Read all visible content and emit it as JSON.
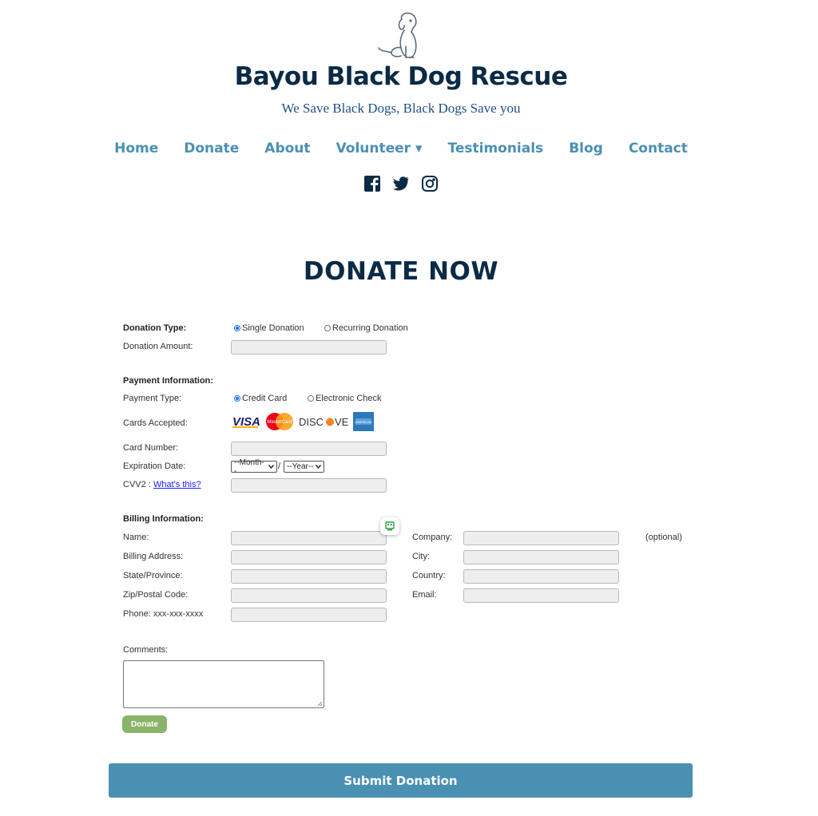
{
  "site": {
    "title": "Bayou Black Dog Rescue",
    "tagline": "We Save Black Dogs, Black Dogs Save you"
  },
  "nav": {
    "items": [
      "Home",
      "Donate",
      "About",
      "Volunteer ▾",
      "Testimonials",
      "Blog",
      "Contact"
    ]
  },
  "social": {
    "icons": [
      "facebook-icon",
      "twitter-icon",
      "instagram-icon"
    ]
  },
  "page": {
    "heading": "DONATE NOW"
  },
  "form": {
    "donation_type_label": "Donation Type:",
    "donation_type_options": [
      "Single Donation",
      "Recurring Donation"
    ],
    "donation_type_selected": "Single Donation",
    "donation_amount_label": "Donation Amount:",
    "payment_info_heading": "Payment Information:",
    "payment_type_label": "Payment Type:",
    "payment_type_options": [
      "Credit Card",
      "Electronic Check"
    ],
    "payment_type_selected": "Credit Card",
    "cards_accepted_label": "Cards Accepted:",
    "cards": [
      "VISA",
      "MasterCard",
      "DISCOVER",
      "American Express"
    ],
    "card_number_label": "Card Number:",
    "expiration_label": "Expiration Date:",
    "month_select": "--Month--",
    "year_select": "--Year--",
    "date_separator": "/",
    "cvv_label": "CVV2 :",
    "cvv_link": "What's this?",
    "billing_heading": "Billing Information:",
    "name_label": "Name:",
    "company_label": "Company:",
    "optional_note": "(optional)",
    "billing_address_label": "Billing Address:",
    "city_label": "City:",
    "state_label": "State/Province:",
    "country_label": "Country:",
    "zip_label": "Zip/Postal Code:",
    "email_label": "Email:",
    "phone_label": "Phone: xxx-xxx-xxxx",
    "comments_label": "Comments:",
    "donate_button": "Donate",
    "submit_button": "Submit Donation"
  },
  "colors": {
    "title": "#0b2a45",
    "tagline": "#1f4f86",
    "nav": "#4a90b3",
    "submit": "#4a90b3",
    "donate_button": "#8ab46a"
  }
}
